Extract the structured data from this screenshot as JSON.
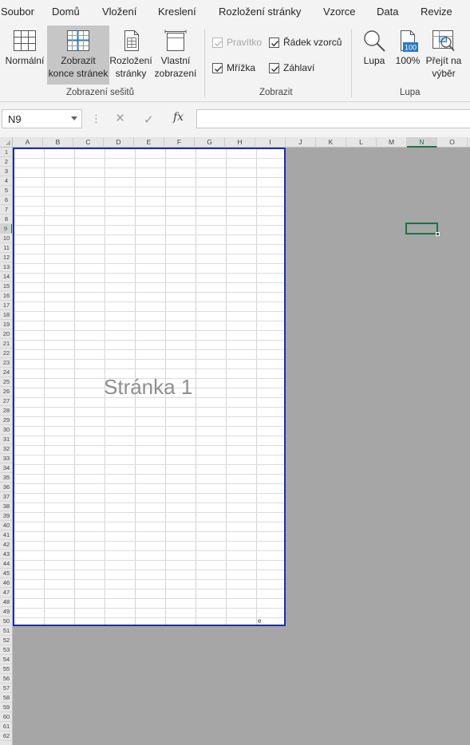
{
  "menu": {
    "tabs": [
      "Soubor",
      "Domů",
      "Vložení",
      "Kreslení",
      "Rozložení stránky",
      "Vzorce",
      "Data",
      "Revize"
    ]
  },
  "ribbon": {
    "workbook_views": {
      "group_label": "Zobrazení sešitů",
      "normal_label": "Normální",
      "page_break_label_1": "Zobrazit",
      "page_break_label_2": "konce stránek",
      "page_layout_label_1": "Rozložení",
      "page_layout_label_2": "stránky",
      "custom_views_label_1": "Vlastní",
      "custom_views_label_2": "zobrazení"
    },
    "show": {
      "group_label": "Zobrazit",
      "ruler_label": "Pravítko",
      "ruler_checked": true,
      "ruler_disabled": true,
      "formula_bar_label": "Řádek vzorců",
      "formula_bar_checked": true,
      "gridlines_label": "Mřížka",
      "gridlines_checked": true,
      "headings_label": "Záhlaví",
      "headings_checked": true
    },
    "zoom": {
      "group_label": "Lupa",
      "zoom_label": "Lupa",
      "zoom100_label": "100%",
      "zoom100_badge": "100",
      "zoom_selection_label_1": "Přejít na",
      "zoom_selection_label_2": "výběr"
    }
  },
  "formula_bar": {
    "name_box": "N9",
    "fx_label": "fx",
    "cancel_icon": "×",
    "enter_icon": "✓",
    "dots_icon": "⋮",
    "formula": ""
  },
  "sheet": {
    "columns": [
      "A",
      "B",
      "C",
      "D",
      "E",
      "F",
      "G",
      "H",
      "I",
      "J",
      "K",
      "L",
      "M",
      "N",
      "O"
    ],
    "selected_column": "N",
    "rows": [
      "1",
      "2",
      "3",
      "4",
      "5",
      "6",
      "7",
      "8",
      "9",
      "10",
      "11",
      "12",
      "13",
      "14",
      "15",
      "16",
      "17",
      "18",
      "19",
      "20",
      "21",
      "22",
      "23",
      "24",
      "25",
      "26",
      "27",
      "28",
      "29",
      "30",
      "31",
      "32",
      "33",
      "34",
      "35",
      "36",
      "37",
      "38",
      "39",
      "40",
      "41",
      "42",
      "43",
      "44",
      "45",
      "46",
      "47",
      "48",
      "49",
      "50",
      "51",
      "52",
      "53",
      "54",
      "55",
      "56",
      "57",
      "58",
      "59",
      "60",
      "61",
      "62"
    ],
    "selected_row": "9",
    "page_label": "Stránka 1",
    "cell_text": "e",
    "colors": {
      "page_border": "#1c2fa5",
      "selection": "#1e7145",
      "outside_page": "#a6a6a6"
    }
  }
}
